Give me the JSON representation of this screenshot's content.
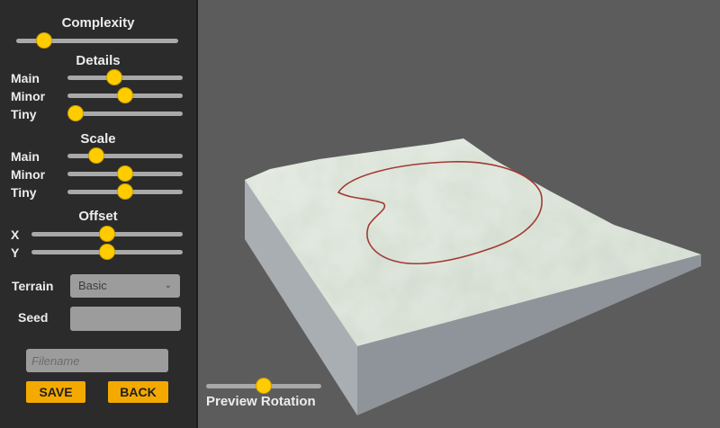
{
  "panel": {
    "complexity": {
      "title": "Complexity",
      "value": 0.17
    },
    "details": {
      "title": "Details",
      "main": {
        "label": "Main",
        "value": 0.41
      },
      "minor": {
        "label": "Minor",
        "value": 0.5
      },
      "tiny": {
        "label": "Tiny",
        "value": 0.07
      }
    },
    "scale": {
      "title": "Scale",
      "main": {
        "label": "Main",
        "value": 0.25
      },
      "minor": {
        "label": "Minor",
        "value": 0.5
      },
      "tiny": {
        "label": "Tiny",
        "value": 0.5
      }
    },
    "offset": {
      "title": "Offset",
      "x": {
        "label": "X",
        "value": 0.5
      },
      "y": {
        "label": "Y",
        "value": 0.5
      }
    },
    "terrain": {
      "label": "Terrain",
      "selected": "Basic"
    },
    "seed": {
      "label": "Seed",
      "value": ""
    },
    "filename": {
      "placeholder": "Filename",
      "value": ""
    },
    "save_label": "SAVE",
    "back_label": "BACK"
  },
  "preview": {
    "rotation_label": "Preview Rotation",
    "rotation_value": 0.5
  },
  "colors": {
    "background": "#5c5c5c",
    "panel": "#2b2b2b",
    "accent": "#ffcc00",
    "button": "#f4a900",
    "terrain_top": "#dfe6dc",
    "contour": "#a23a32"
  },
  "icons": {
    "dropdown": "chevron-down-icon"
  }
}
